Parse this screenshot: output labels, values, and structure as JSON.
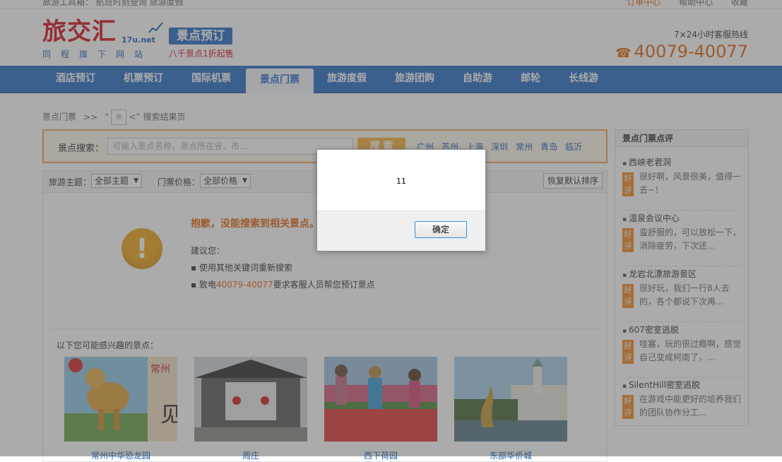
{
  "topbar": {
    "left_text": "旅游工具箱：  航班时刻查询   旅游度假",
    "links": [
      "订单中心",
      "帮助中心",
      "收藏"
    ]
  },
  "header": {
    "brand": "旅交汇",
    "domain": "17u.net",
    "slogan": "同程旗下网站",
    "badge": "景点预订",
    "badge_sub": "八千景点1折起售",
    "hotline_label": "7×24小时客服热线",
    "hotline": "40079-40077"
  },
  "nav": {
    "items": [
      "酒店预订",
      "机票预订",
      "国际机票",
      "景点门票",
      "旅游度假",
      "旅游团购",
      "自助游",
      "邮轮",
      "长线游"
    ],
    "active": "景点门票"
  },
  "breadcrumb": {
    "root": "景点门票",
    "sep": ">>",
    "quote_open": "“",
    "quote_close": "<”",
    "current": "搜索结果页"
  },
  "search": {
    "label": "景点搜索：",
    "placeholder": "可输入景点名称，景点所在省、市...",
    "button": "搜 索",
    "cities": [
      "广州",
      "苏州",
      "上海",
      "深圳",
      "常州",
      "青岛",
      "临沂"
    ]
  },
  "filters": {
    "theme_label": "旅游主题：",
    "theme_value": "全部主题",
    "price_label": "门票价格：",
    "price_value": "全部价格",
    "reset": "恢复默认排序"
  },
  "result": {
    "sorry": "抱歉，没能搜索到相关景点。",
    "suggest": "建议您：",
    "tip1": "▪ 使用其他关键词重新搜索",
    "tip2_prefix": "▪ 致电",
    "tip2_phone": "40079-40077",
    "tip2_suffix": "要求客服人员帮您预订景点",
    "interest": "以下您可能感兴趣的景点：",
    "spots": [
      "常州中华恐龙园",
      "周庄",
      "西下荷园",
      "东部华侨城"
    ]
  },
  "sidebar": {
    "title": "景点门票点评",
    "tag": "好评",
    "reviews": [
      {
        "name": "西峡老君洞",
        "text": "很好啊，风景很美，值得一去~！"
      },
      {
        "name": "温泉会议中心",
        "text": "蛮舒服的，可以放松一下，消除疲劳，下次还..."
      },
      {
        "name": "龙岩北漂旅游景区",
        "text": "很好玩，我们一行8人去的，各个都说下次再..."
      },
      {
        "name": "607密室逃脱",
        "text": "哇塞，玩的很过瘾啊，感觉自己变成柯南了，..."
      },
      {
        "name": "SilentHill密室逃脱",
        "text": "在游戏中能更好的培养我们的团队协作分工..."
      }
    ]
  },
  "dialog": {
    "message": "11",
    "ok": "确定"
  },
  "colors": {
    "nav_blue": "#2a6ec5",
    "accent_orange": "#e2650b",
    "brand_red": "#d4121a"
  }
}
